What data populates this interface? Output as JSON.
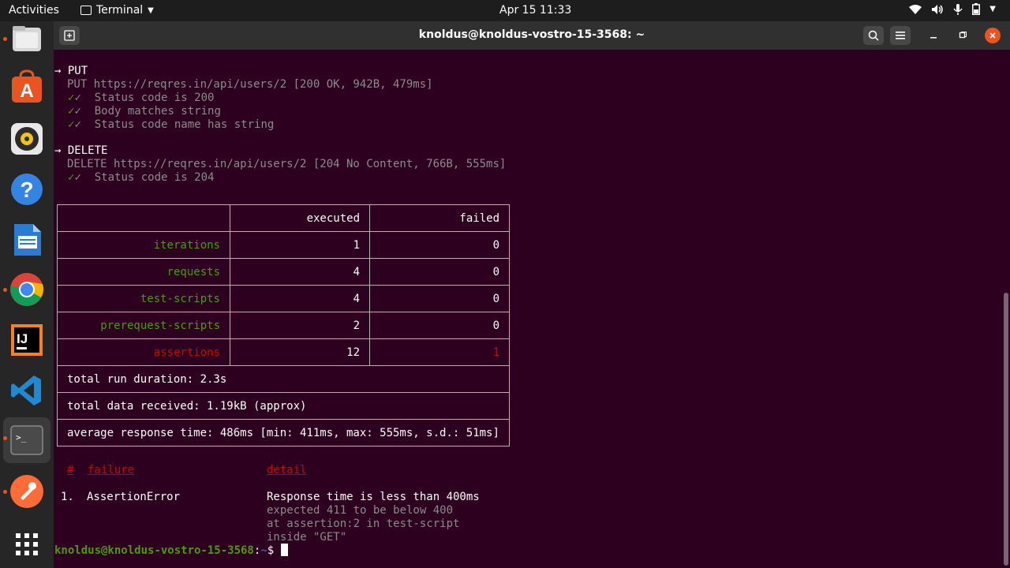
{
  "topbar": {
    "activities": "Activities",
    "app_name": "Terminal",
    "clock": "Apr 15  11:33"
  },
  "dock": {
    "items": [
      "files",
      "ubuntu-software",
      "rhythmbox",
      "help",
      "libreoffice-writer",
      "chrome",
      "intellij",
      "vscode",
      "terminal",
      "postman",
      "show-applications"
    ]
  },
  "window": {
    "title": "knoldus@knoldus-vostro-15-3568: ~"
  },
  "output": {
    "put_header": "→ PUT",
    "put_request": "PUT https://reqres.in/api/users/2 [200 OK, 942B, 479ms]",
    "put_tests": [
      "✓  Status code is 200",
      "✓  Body matches string",
      "✓  Status code name has string"
    ],
    "delete_header": "→ DELETE",
    "delete_request": "DELETE https://reqres.in/api/users/2 [204 No Content, 766B, 555ms]",
    "delete_tests": [
      "✓  Status code is 204"
    ]
  },
  "stats": {
    "headers": [
      "",
      "executed",
      "failed"
    ],
    "rows": [
      {
        "label": "iterations",
        "executed": "1",
        "failed": "0"
      },
      {
        "label": "requests",
        "executed": "4",
        "failed": "0"
      },
      {
        "label": "test-scripts",
        "executed": "4",
        "failed": "0"
      },
      {
        "label": "prerequest-scripts",
        "executed": "2",
        "failed": "0"
      },
      {
        "label": "assertions",
        "executed": "12",
        "failed": "1"
      }
    ],
    "duration": "total run duration: 2.3s",
    "data_received": "total data received: 1.19kB (approx)",
    "response_time": "average response time: 486ms [min: 411ms, max: 555ms, s.d.: 51ms]"
  },
  "failures": {
    "col_num": "#",
    "col_failure": "failure",
    "col_detail": "detail",
    "items": [
      {
        "num": "1.",
        "name": "AssertionError",
        "detail": "Response time is less than 400ms",
        "extra": [
          "expected 411 to be below 400",
          "at assertion:2 in test-script",
          "inside \"GET\""
        ]
      }
    ]
  },
  "prompt": {
    "user": "knoldus@knoldus-vostro-15-3568",
    "sep": ":",
    "path": "~",
    "symbol": "$"
  },
  "colors": {
    "terminal_bg": "#2c001e",
    "green": "#4e9a06",
    "red": "#cc0000",
    "accent": "#e95420"
  }
}
